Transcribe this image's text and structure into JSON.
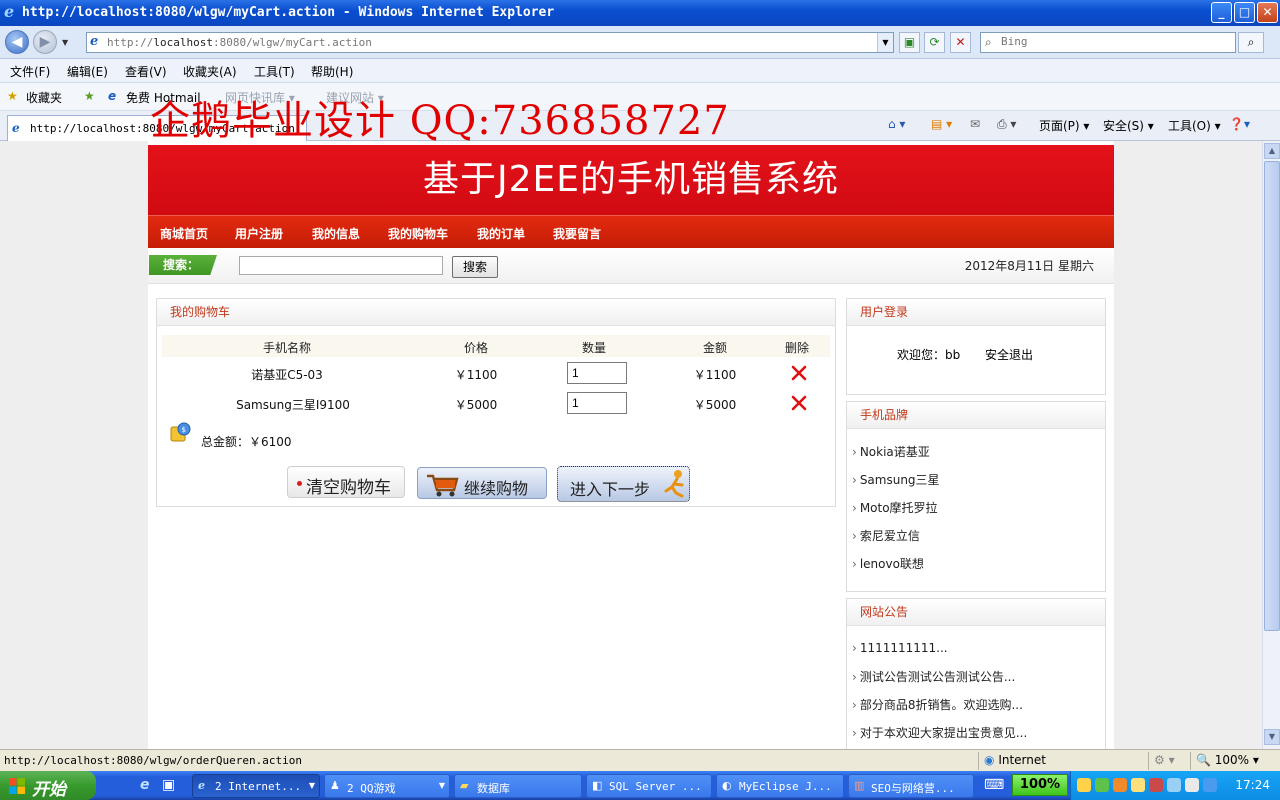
{
  "window": {
    "title": "http://localhost:8080/wlgw/myCart.action - Windows Internet Explorer",
    "minimize_label": "_",
    "maximize_label": "□",
    "close_label": "✕"
  },
  "addressbar": {
    "url_prefix": "http://",
    "url_host": "localhost",
    "url_rest": ":8080/wlgw/myCart.action",
    "search_placeholder": "Bing"
  },
  "menu": [
    "文件(F)",
    "编辑(E)",
    "查看(V)",
    "收藏夹(A)",
    "工具(T)",
    "帮助(H)"
  ],
  "favorites": {
    "favorites_label": "收藏夹",
    "free_label": "免费 Hotmail",
    "item_dim_1": "网页快讯库 ▾",
    "item_dim_2": "建议网站 ▾"
  },
  "watermark": "企鹅毕业设计 QQ:736858727",
  "tab": {
    "title": "http://localhost:8080/wlgw/myCart.action"
  },
  "commandbar": {
    "page": "页面(P) ▾",
    "safety": "安全(S) ▾",
    "tools": "工具(O) ▾"
  },
  "site": {
    "banner_title": "基于J2EE的手机销售系统",
    "nav": [
      "商城首页",
      "用户注册",
      "我的信息",
      "我的购物车",
      "我的订单",
      "我要留言"
    ],
    "search_label": "搜索：",
    "search_button": "搜索",
    "date": "2012年8月11日 星期六"
  },
  "cart": {
    "title": "我的购物车",
    "headers": [
      "手机名称",
      "价格",
      "数量",
      "金额",
      "删除"
    ],
    "rows": [
      {
        "name": "诺基亚C5-03",
        "price": "￥1100",
        "qty": "1",
        "amount": "￥1100"
      },
      {
        "name": "Samsung三星I9100",
        "price": "￥5000",
        "qty": "1",
        "amount": "￥5000"
      }
    ],
    "total": "总金额：￥6100",
    "clear_button": "清空购物车",
    "continue_button": "继续购物",
    "next_button": "进入下一步"
  },
  "sidebar": {
    "login": {
      "title": "用户登录",
      "welcome": "欢迎您：bb",
      "logout": "安全退出"
    },
    "brands": {
      "title": "手机品牌",
      "items": [
        "Nokia诺基亚",
        "Samsung三星",
        "Moto摩托罗拉",
        "索尼爱立信",
        "lenovo联想"
      ]
    },
    "notices": {
      "title": "网站公告",
      "items": [
        "1111111111...",
        "测试公告测试公告测试公告...",
        "部分商品8折销售。欢迎选购...",
        "对于本欢迎大家提出宝贵意见..."
      ]
    }
  },
  "statusbar": {
    "text": "http://localhost:8080/wlgw/orderQueren.action",
    "zone": "Internet",
    "zoom": "100% ▾"
  },
  "taskbar": {
    "start": "开始",
    "tasks": [
      "2 Internet...",
      "2 QQ游戏",
      "数据库",
      "SQL Server ...",
      "MyEclipse J...",
      "SEO与网络营..."
    ],
    "percent": "100%",
    "clock": "17:24"
  },
  "colors": {
    "banner_red": "#d10a12",
    "nav_red": "#c61d07",
    "panel_title": "#c0391b",
    "watermark_red": "#e10000"
  }
}
